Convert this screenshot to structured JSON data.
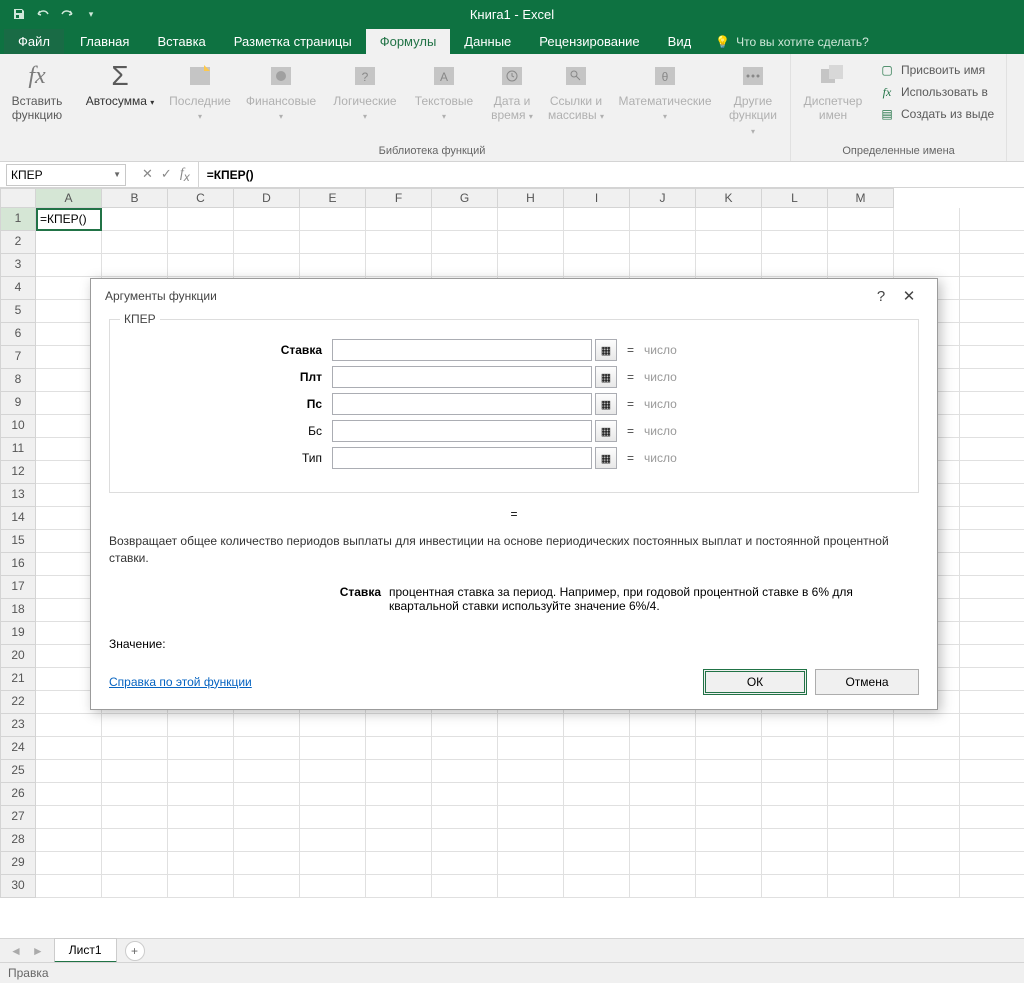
{
  "title": "Книга1 - Excel",
  "tabs": {
    "file": "Файл",
    "home": "Главная",
    "insert": "Вставка",
    "layout": "Разметка страницы",
    "formulas": "Формулы",
    "data": "Данные",
    "review": "Рецензирование",
    "view": "Вид"
  },
  "tellme": "Что вы хотите сделать?",
  "ribbon": {
    "insert_fn": "Вставить\nфункцию",
    "autosum": "Автосумма",
    "recent": "Последние",
    "financial": "Финансовые",
    "logical": "Логические",
    "text": "Текстовые",
    "date": "Дата и\nвремя",
    "lookup": "Ссылки и\nмассивы",
    "math": "Математические",
    "more": "Другие\nфункции",
    "lib_label": "Библиотека функций",
    "name_mgr": "Диспетчер\nимен",
    "define": "Присвоить имя",
    "use": "Использовать в",
    "create": "Создать из выде",
    "names_label": "Определенные имена"
  },
  "namebox": "КПЕР",
  "formula": "=КПЕР()",
  "cell_a1": "=КПЕР()",
  "cols": [
    "A",
    "B",
    "C",
    "D",
    "E",
    "F",
    "G",
    "H",
    "I",
    "J",
    "K",
    "L",
    "M"
  ],
  "dialog": {
    "title": "Аргументы функции",
    "fn": "КПЕР",
    "args": [
      {
        "label": "Ставка",
        "bold": true,
        "type": "число"
      },
      {
        "label": "Плт",
        "bold": true,
        "type": "число"
      },
      {
        "label": "Пс",
        "bold": true,
        "type": "число"
      },
      {
        "label": "Бс",
        "bold": false,
        "type": "число"
      },
      {
        "label": "Тип",
        "bold": false,
        "type": "число"
      }
    ],
    "eq": "=",
    "desc": "Возвращает общее количество периодов выплаты для инвестиции на основе периодических постоянных выплат и постоянной процентной ставки.",
    "arg_name": "Ставка",
    "arg_desc": "процентная ставка за период. Например, при годовой процентной ставке в 6% для квартальной ставки используйте значение 6%/4.",
    "value": "Значение:",
    "help": "Справка по этой функции",
    "ok": "ОК",
    "cancel": "Отмена"
  },
  "sheet_tab": "Лист1",
  "status": "Правка"
}
